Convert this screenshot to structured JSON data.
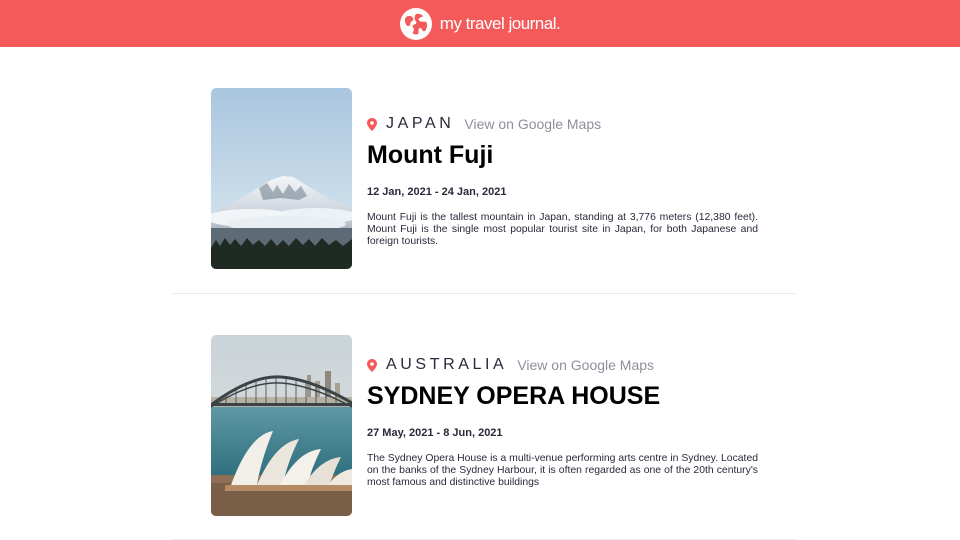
{
  "header": {
    "brand_name": "my travel journal.",
    "icon": "globe-icon",
    "background_color": "#f55a5a"
  },
  "entries": [
    {
      "country": "JAPAN",
      "maps_link": "View on Google Maps",
      "title": "Mount Fuji",
      "dates": "12 Jan, 2021 - 24 Jan, 2021",
      "description": "Mount Fuji is the tallest mountain in Japan, standing at 3,776 meters (12,380 feet). Mount Fuji is the single most popular tourist site in Japan, for both Japanese and foreign tourists.",
      "image": "mount-fuji-photo",
      "pin_icon": "location-pin-icon",
      "pin_color": "#f55a5a"
    },
    {
      "country": "AUSTRALIA",
      "maps_link": "View on Google Maps",
      "title": "SYDNEY OPERA HOUSE",
      "dates": "27 May, 2021 - 8 Jun, 2021",
      "description": "The Sydney Opera House is a multi-venue performing arts centre in Sydney. Located on the banks of the Sydney Harbour, it is often regarded as one of the 20th century's most famous and distinctive buildings",
      "image": "sydney-opera-house-photo",
      "pin_icon": "location-pin-icon",
      "pin_color": "#f55a5a"
    }
  ]
}
